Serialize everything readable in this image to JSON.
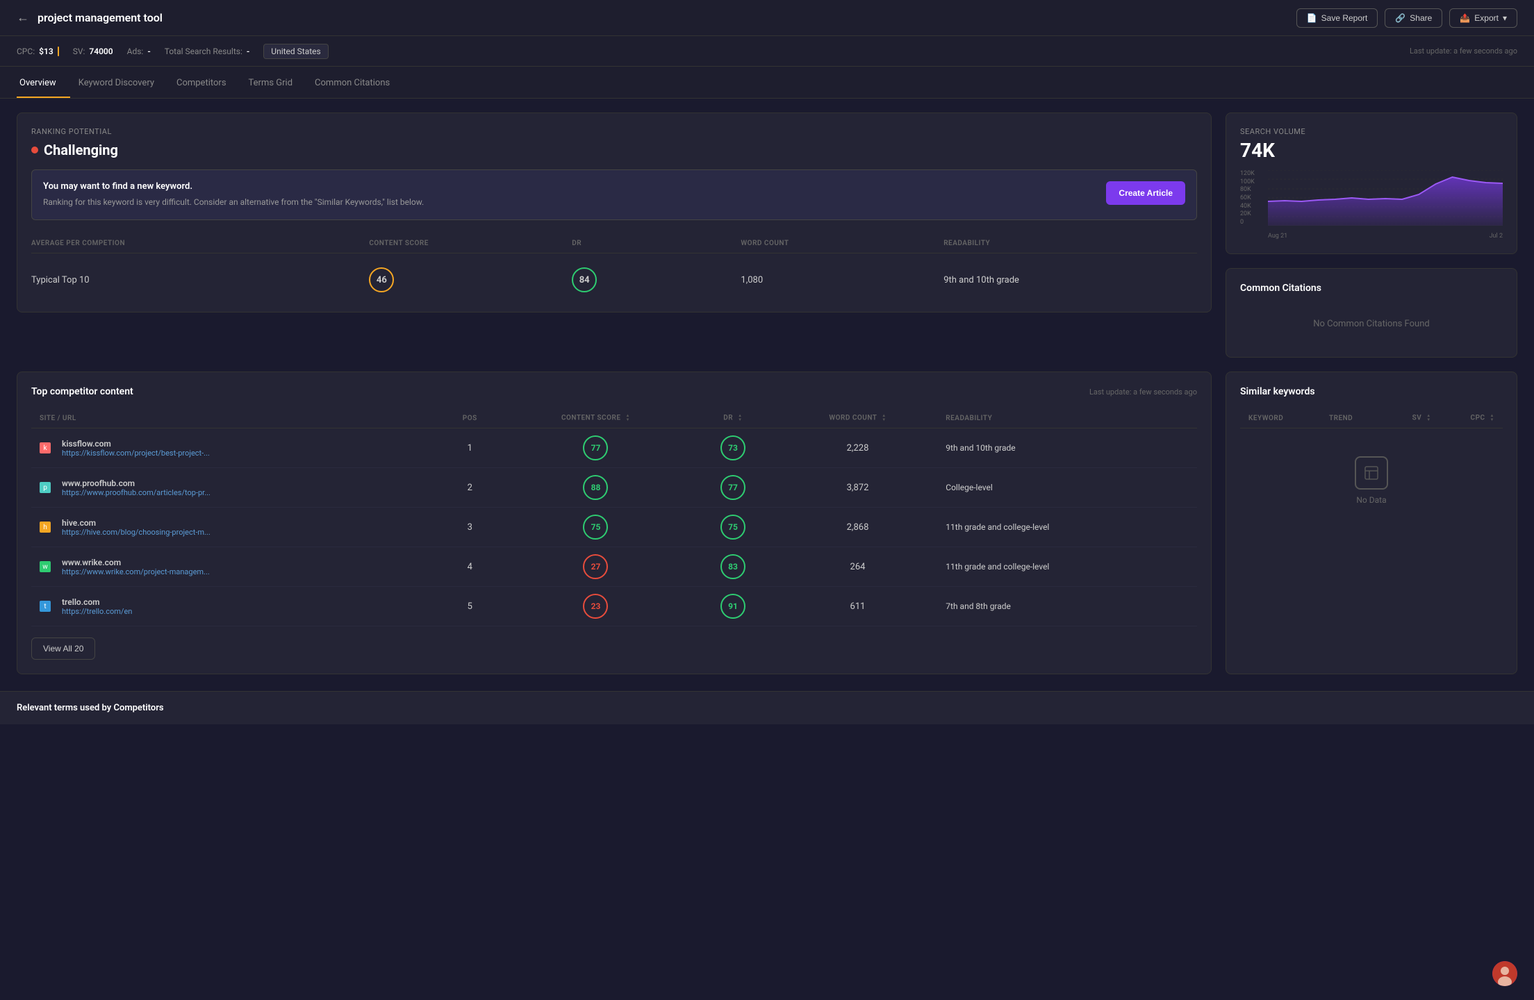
{
  "header": {
    "back_label": "←",
    "title": "project management tool",
    "save_report_label": "Save Report",
    "share_label": "Share",
    "export_label": "Export"
  },
  "metrics": {
    "cpc_label": "CPC:",
    "cpc_value": "$13",
    "sv_label": "SV:",
    "sv_value": "74000",
    "ads_label": "Ads:",
    "ads_value": "-",
    "total_search_label": "Total Search Results:",
    "total_search_value": "-",
    "location": "United States",
    "last_update": "Last update: a few seconds ago"
  },
  "tabs": [
    {
      "id": "overview",
      "label": "Overview",
      "active": true
    },
    {
      "id": "keyword-discovery",
      "label": "Keyword Discovery",
      "active": false
    },
    {
      "id": "competitors",
      "label": "Competitors",
      "active": false
    },
    {
      "id": "terms-grid",
      "label": "Terms Grid",
      "active": false
    },
    {
      "id": "common-citations",
      "label": "Common Citations",
      "active": false
    }
  ],
  "ranking_potential": {
    "label": "Ranking Potential",
    "value": "Challenging",
    "alert_heading": "You may want to find a new keyword.",
    "alert_body": "Ranking for this keyword is very difficult. Consider an alternative from the \"Similar Keywords,\" list below.",
    "create_article_label": "Create Article"
  },
  "averages": {
    "section_label": "AVERAGE PER COMPETION",
    "content_score_label": "CONTENT SCORE",
    "dr_label": "DR",
    "word_count_label": "WORD COUNT",
    "readability_label": "READABILITY",
    "row_label": "Typical Top 10",
    "content_score_value": "46",
    "dr_value": "84",
    "word_count_value": "1,080",
    "readability_value": "9th and 10th grade"
  },
  "search_volume": {
    "label": "Search Volume",
    "value": "74K",
    "chart_y_labels": [
      "120K",
      "100K",
      "80K",
      "60K",
      "40K",
      "20K",
      "0"
    ],
    "chart_x_labels": [
      "Aug 21",
      "Jul 2"
    ],
    "chart_data": [
      55,
      57,
      55,
      58,
      60,
      62,
      60,
      61,
      60,
      65,
      80,
      95,
      90,
      85
    ]
  },
  "common_citations": {
    "title": "Common Citations",
    "no_data_label": "No Common Citations Found"
  },
  "top_competitor": {
    "title": "Top competitor content",
    "last_update": "Last update: a few seconds ago",
    "columns": {
      "site_url": "SITE / URL",
      "pos": "POS",
      "content_score": "CONTENT SCORE",
      "dr": "DR",
      "word_count": "WORD COUNT",
      "readability": "READABILITY"
    },
    "rows": [
      {
        "favicon_class": "favicon-k",
        "favicon_letter": "k",
        "site": "kissflow.com",
        "url": "https://kissflow.com/project/best-project-...",
        "pos": "1",
        "content_score": "77",
        "cs_class": "score-green",
        "dr": "73",
        "dr_class": "score-green",
        "word_count": "2,228",
        "readability": "9th and 10th grade"
      },
      {
        "favicon_class": "favicon-p",
        "favicon_letter": "p",
        "site": "www.proofhub.com",
        "url": "https://www.proofhub.com/articles/top-pr...",
        "pos": "2",
        "content_score": "88",
        "cs_class": "score-green",
        "dr": "77",
        "dr_class": "score-green",
        "word_count": "3,872",
        "readability": "College-level"
      },
      {
        "favicon_class": "favicon-h",
        "favicon_letter": "h",
        "site": "hive.com",
        "url": "https://hive.com/blog/choosing-project-m...",
        "pos": "3",
        "content_score": "75",
        "cs_class": "score-green",
        "dr": "75",
        "dr_class": "score-green",
        "word_count": "2,868",
        "readability": "11th grade and college-level"
      },
      {
        "favicon_class": "favicon-w",
        "favicon_letter": "w",
        "site": "www.wrike.com",
        "url": "https://www.wrike.com/project-managem...",
        "pos": "4",
        "content_score": "27",
        "cs_class": "score-red",
        "dr": "83",
        "dr_class": "score-green",
        "word_count": "264",
        "readability": "11th grade and college-level"
      },
      {
        "favicon_class": "favicon-t",
        "favicon_letter": "t",
        "site": "trello.com",
        "url": "https://trello.com/en",
        "pos": "5",
        "content_score": "23",
        "cs_class": "score-red",
        "dr": "91",
        "dr_class": "score-green",
        "word_count": "611",
        "readability": "7th and 8th grade"
      }
    ],
    "view_all_label": "View All 20"
  },
  "similar_keywords": {
    "title": "Similar keywords",
    "columns": {
      "keyword": "KEYWORD",
      "trend": "TREND",
      "sv": "SV",
      "cpc": "CPC"
    },
    "no_data_label": "No Data"
  },
  "relevant_terms": {
    "title": "Relevant terms used by Competitors"
  }
}
